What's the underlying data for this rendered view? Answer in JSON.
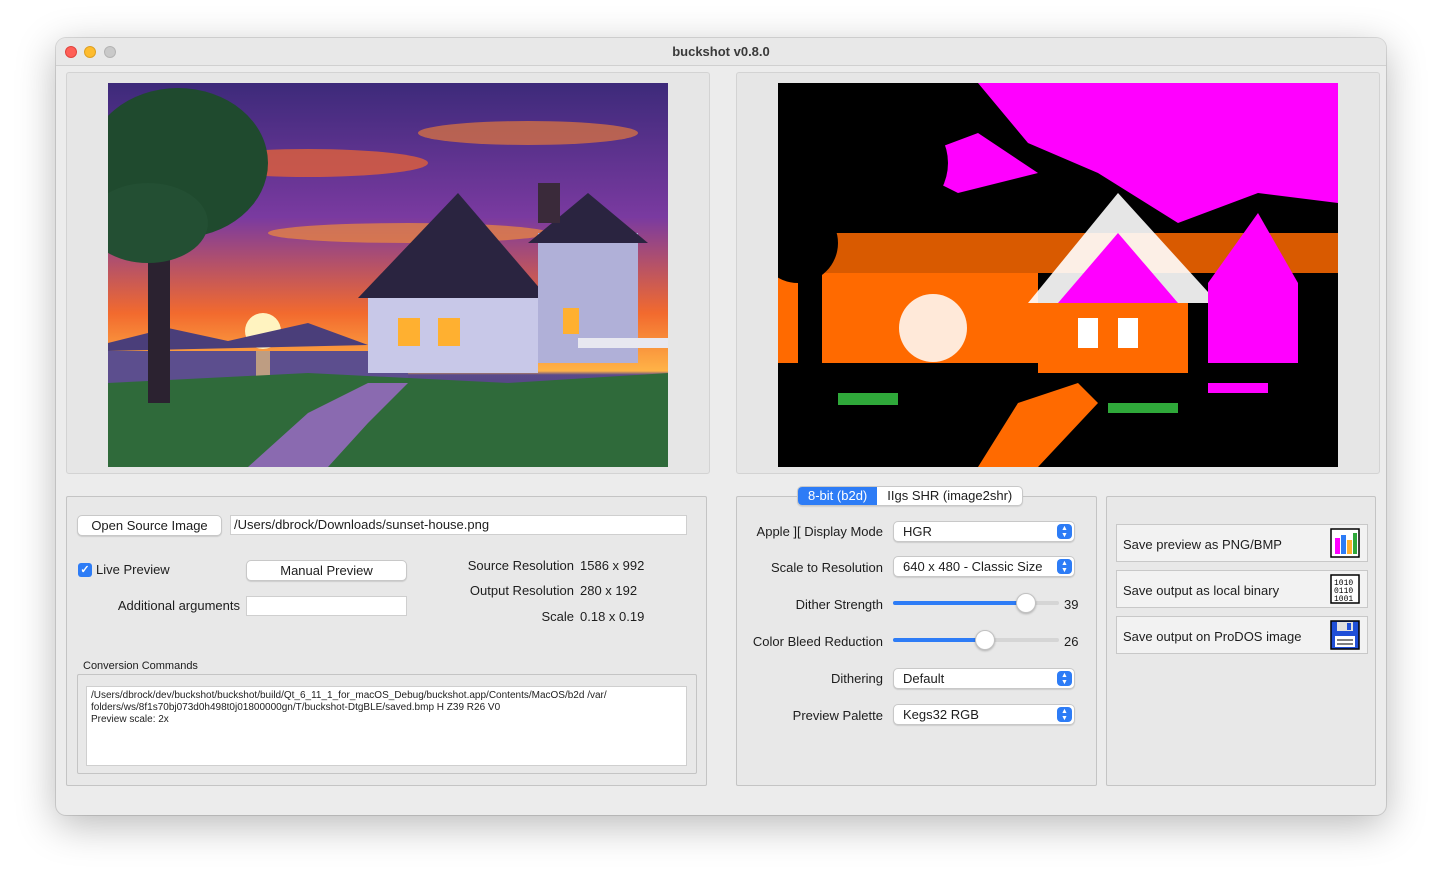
{
  "window": {
    "title": "buckshot  v0.8.0"
  },
  "source": {
    "open_button": "Open Source Image",
    "path": "/Users/dbrock/Downloads/sunset-house.png",
    "live_preview_label": "Live Preview",
    "live_preview_checked": true,
    "manual_preview_button": "Manual Preview",
    "additional_args_label": "Additional arguments",
    "additional_args_value": "",
    "source_resolution_label": "Source Resolution",
    "source_resolution_value": "1586 x 992",
    "output_resolution_label": "Output Resolution",
    "output_resolution_value": "280 x 192",
    "scale_label": "Scale",
    "scale_value": "0.18 x 0.19"
  },
  "conversion": {
    "group_label": "Conversion Commands",
    "line1": "/Users/dbrock/dev/buckshot/buckshot/build/Qt_6_11_1_for_macOS_Debug/buckshot.app/Contents/MacOS/b2d /var/",
    "line2": "folders/ws/8f1s70bj073d0h498t0j01800000gn/T/buckshot-DtgBLE/saved.bmp H Z39 R26 V0",
    "line3": "Preview scale: 2x"
  },
  "tabs": [
    {
      "label": "8-bit (b2d)",
      "active": true
    },
    {
      "label": "IIgs SHR (image2shr)",
      "active": false
    }
  ],
  "settings": {
    "display_mode_label": "Apple ][ Display Mode",
    "display_mode_value": "HGR",
    "scale_label": "Scale to Resolution",
    "scale_value": "640 x 480 - Classic Size",
    "dither_strength_label": "Dither Strength",
    "dither_strength_value": "39",
    "dither_strength_fraction": 0.39,
    "color_bleed_label": "Color Bleed Reduction",
    "color_bleed_value": "26",
    "color_bleed_fraction": 0.26,
    "dithering_label": "Dithering",
    "dithering_value": "Default",
    "palette_label": "Preview Palette",
    "palette_value": "Kegs32 RGB"
  },
  "save": {
    "png": "Save preview as PNG/BMP",
    "binary": "Save output as local binary",
    "prodos": "Save output on ProDOS image"
  },
  "colors": {
    "accent": "#2d7cf6",
    "magenta": "#ff00ff",
    "orange": "#ff6a00"
  }
}
